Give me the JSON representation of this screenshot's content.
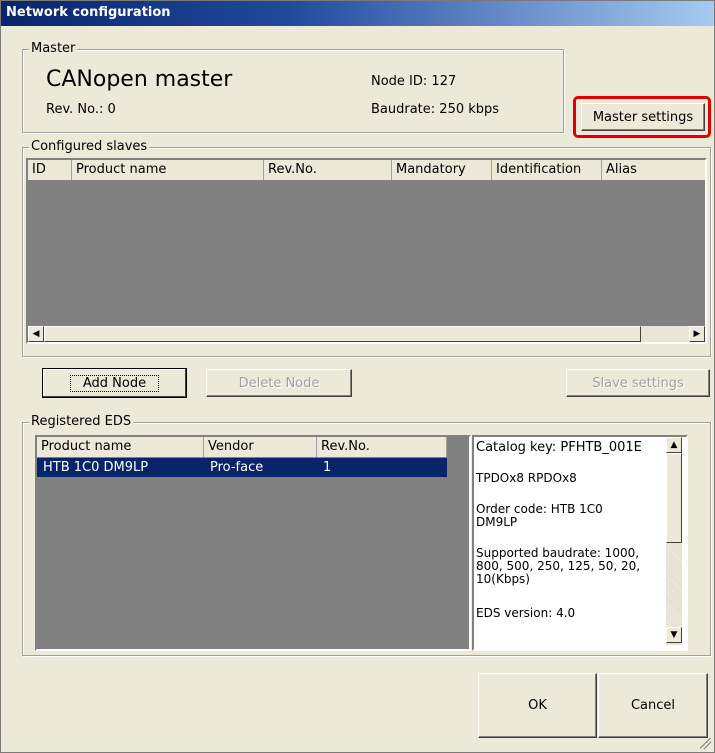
{
  "window": {
    "title": "Network configuration"
  },
  "master": {
    "group_label": "Master",
    "name": "CANopen master",
    "rev_label": "Rev. No.: 0",
    "node_id_label": "Node ID: 127",
    "baudrate_label": "Baudrate: 250 kbps",
    "settings_button": "Master settings"
  },
  "slaves": {
    "group_label": "Configured slaves",
    "columns": [
      "ID",
      "Product name",
      "Rev.No.",
      "Mandatory",
      "Identification",
      "Alias"
    ],
    "rows": []
  },
  "buttons": {
    "add_node": "Add Node",
    "delete_node": "Delete Node",
    "slave_settings": "Slave settings",
    "ok": "OK",
    "cancel": "Cancel"
  },
  "eds": {
    "group_label": "Registered EDS",
    "columns": [
      "Product name",
      "Vendor",
      "Rev.No."
    ],
    "rows": [
      {
        "product": "HTB 1C0 DM9LP",
        "vendor": "Pro-face",
        "rev": "1"
      }
    ],
    "details": {
      "catalog_key": "Catalog key: PFHTB_001E",
      "pdo": "TPDOx8 RPDOx8",
      "order_code": "Order code: HTB 1C0 DM9LP",
      "baudrate": "Supported baudrate: 1000, 800, 500, 250, 125, 50, 20, 10(Kbps)",
      "eds_version": "EDS version: 4.0"
    }
  },
  "icons": {
    "scroll_left": "◀",
    "scroll_right": "▶",
    "scroll_up": "▲",
    "scroll_down": "▼"
  },
  "colors": {
    "title_start": "#0a246a",
    "selection": "#0a246a",
    "highlight": "#e00000"
  }
}
